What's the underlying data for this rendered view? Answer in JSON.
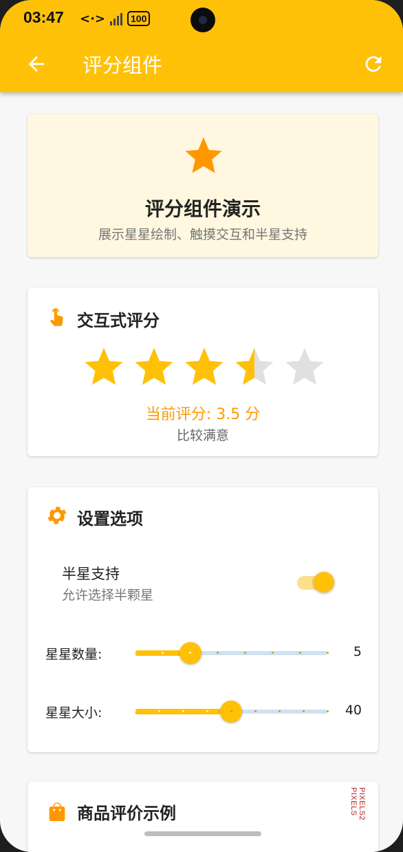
{
  "status_bar": {
    "time": "03:47",
    "battery": "100"
  },
  "app_bar": {
    "title": "评分组件",
    "color": "#ffc107"
  },
  "hero": {
    "title": "评分组件演示",
    "subtitle": "展示星星绘制、触摸交互和半星支持",
    "icon": "star-icon"
  },
  "interactive": {
    "title": "交互式评分",
    "icon": "touch-hand-icon",
    "rating": 3.5,
    "star_count": 5,
    "current_text": "当前评分: 3.5 分",
    "description": "比较满意"
  },
  "settings": {
    "title": "设置选项",
    "icon": "gear-icon",
    "half_star": {
      "label": "半星支持",
      "sublabel": "允许选择半颗星",
      "enabled": true
    },
    "star_count_slider": {
      "label": "星星数量:",
      "value": "5",
      "fraction": 0.29
    },
    "star_size_slider": {
      "label": "星星大小:",
      "value": "40",
      "fraction": 0.5
    }
  },
  "product": {
    "title": "商品评价示例",
    "icon": "shopping-bag-icon"
  },
  "watermark": "PIXELS2 PIXELS",
  "colors": {
    "accent": "#ffc107",
    "star_filled": "#ffc107",
    "star_empty": "#e0e0e0",
    "rating_text": "#ff9800",
    "hero_bg": "#fff7df"
  }
}
